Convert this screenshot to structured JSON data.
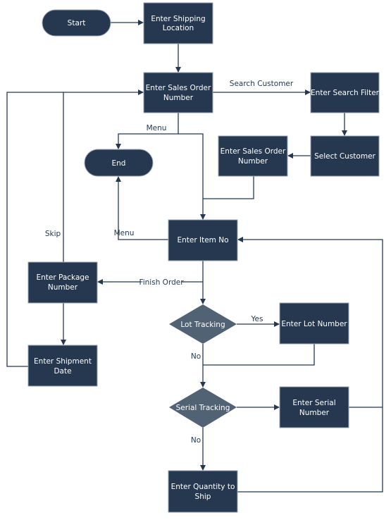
{
  "colors": {
    "node": "#253850",
    "decision": "#516274",
    "edge": "#253850"
  },
  "nodes": {
    "start": "Start",
    "shipping": [
      "Enter Shipping",
      "Location"
    ],
    "sales_order": [
      "Enter Sales Order",
      "Number"
    ],
    "search_filter": "Enter Search Filter",
    "select_customer": "Select Customer",
    "sales_order2": [
      "Enter Sales Order",
      "Number"
    ],
    "end": "End",
    "item_no": "Enter Item No",
    "package": [
      "Enter Package",
      "Number"
    ],
    "shipment_date": [
      "Enter Shipment",
      "Date"
    ],
    "lot_tracking": "Lot Tracking",
    "lot_number": "Enter Lot Number",
    "serial_tracking": "Serial Tracking",
    "serial_number": [
      "Enter Serial",
      "Number"
    ],
    "quantity": [
      "Enter Quantity to",
      "Ship"
    ]
  },
  "edge_labels": {
    "search_customer": "Search Customer",
    "menu1": "Menu",
    "menu2": "Menu",
    "skip": "Skip",
    "finish_order": "Finish Order",
    "yes": "Yes",
    "no1": "No",
    "no2": "No"
  }
}
